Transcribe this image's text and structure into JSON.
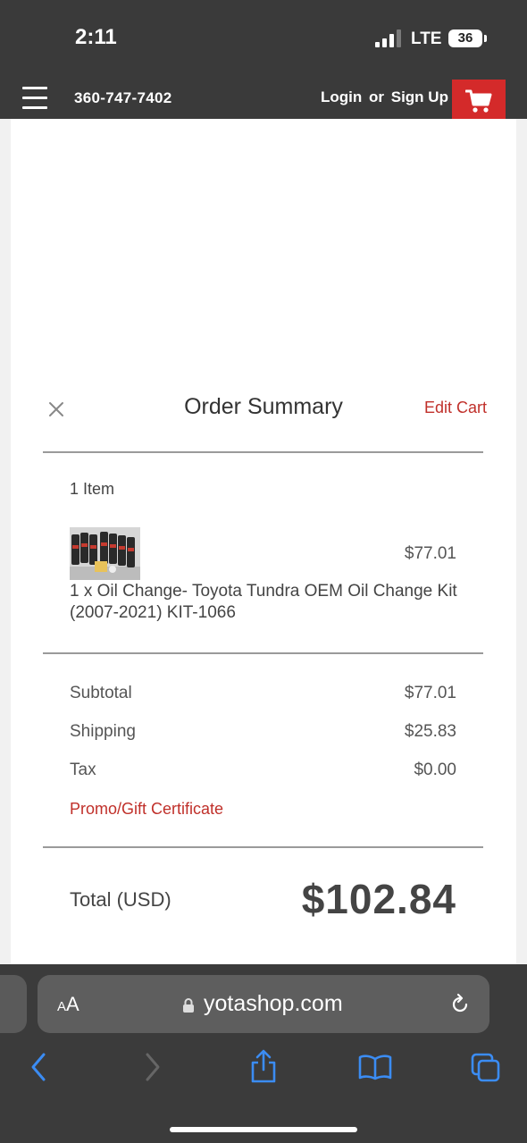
{
  "status": {
    "time": "2:11",
    "network": "LTE",
    "battery": "36"
  },
  "header": {
    "phone": "360-747-7402",
    "login": "Login",
    "or": "or",
    "signup": "Sign Up"
  },
  "summary": {
    "title": "Order Summary",
    "edit_cart": "Edit Cart",
    "item_count": "1 Item",
    "item": {
      "price": "$77.01",
      "description": "1 x Oil Change- Toyota Tundra OEM Oil Change Kit (2007-2021) KIT-1066"
    },
    "lines": [
      {
        "label": "Subtotal",
        "value": "$77.01"
      },
      {
        "label": "Shipping",
        "value": "$25.83"
      },
      {
        "label": "Tax",
        "value": "$0.00"
      }
    ],
    "promo": "Promo/Gift Certificate",
    "total_label": "Total (USD)",
    "total_value": "$102.84"
  },
  "browser": {
    "aa_small": "A",
    "aa_large": "A",
    "url": "yotashop.com"
  },
  "colors": {
    "accent": "#c0302a",
    "cart_button": "#d42a2a",
    "header": "#3a3a3a"
  }
}
